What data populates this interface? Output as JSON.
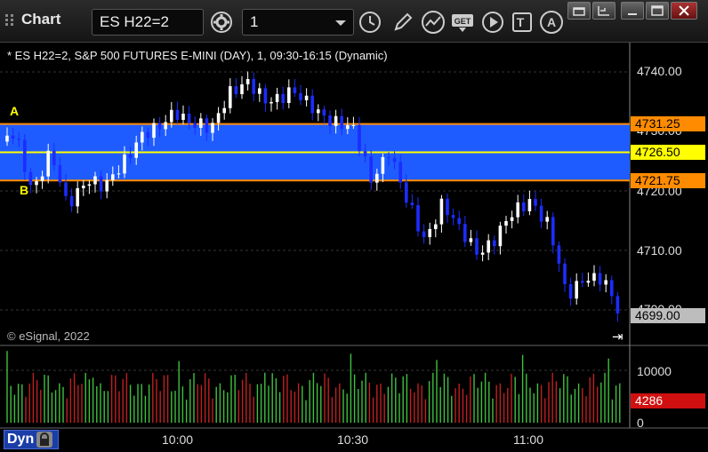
{
  "window": {
    "title": "Chart"
  },
  "toolbar": {
    "symbol": "ES H22=2",
    "interval": "1",
    "icons": [
      "settings-gear-icon",
      "clock-icon",
      "pencil-icon",
      "study-icon",
      "get-icon",
      "play-icon",
      "text-icon",
      "alert-icon"
    ]
  },
  "chart": {
    "legend": "* ES H22=2, S&P 500 FUTURES E-MINI (DAY), 1, 09:30-16:15 (Dynamic)",
    "copyright": "© eSignal, 2022",
    "marker_a": "A",
    "marker_b": "B",
    "price_ticks": [
      "4740.00",
      "4730.00",
      "4720.00",
      "4710.00",
      "4700.00"
    ],
    "volume_ticks": [
      "10000",
      "0"
    ],
    "time_ticks": [
      "10:00",
      "10:30",
      "11:00"
    ],
    "level_upper": "4731.25",
    "level_mid": "4726.50",
    "level_lower": "4721.75",
    "last_price": "4699.00",
    "last_volume": "4286",
    "colors": {
      "band": "#1e5cff",
      "orange": "#ff8c00",
      "yellow": "#ffff00",
      "up": "#ffffff",
      "down": "#1c2cff",
      "vol_up": "#40c040",
      "vol_down": "#c02020"
    }
  },
  "bottom": {
    "mode_label": "Dyn"
  }
}
